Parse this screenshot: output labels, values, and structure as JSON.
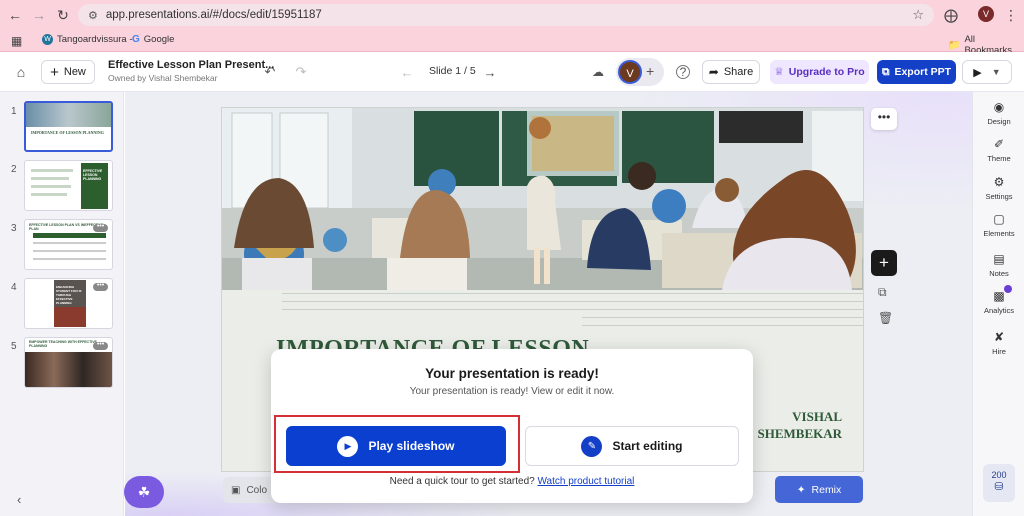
{
  "browser": {
    "url": "app.presentations.ai/#/docs/edit/15951187",
    "profile_initial": "V",
    "bookmarks": [
      {
        "label": "Tangoardvissura -",
        "icon": "wordpress-icon"
      },
      {
        "label": "Google",
        "icon": "google-icon"
      }
    ],
    "all_bookmarks_label": "All Bookmarks"
  },
  "header": {
    "new_label": "New",
    "doc_title": "Effective Lesson Plan Present...",
    "owner": "Owned by Vishal Shembekar",
    "slide_indicator": "Slide 1 / 5",
    "avatar_initial": "V",
    "share_label": "Share",
    "upgrade_label": "Upgrade to Pro",
    "export_label": "Export PPT"
  },
  "slides": [
    {
      "num": "1",
      "caption": "IMPORTANCE OF LESSON PLANNING"
    },
    {
      "num": "2",
      "caption": "EFFECTIVE LESSON PLANNING"
    },
    {
      "num": "3",
      "caption": "EFFECTIVE LESSON PLAN VS INEFFECTIVE PLAN"
    },
    {
      "num": "4",
      "caption": "ENHANCING STUDENT FOCUS THROUGH EFFECTIVE PLANNING"
    },
    {
      "num": "5",
      "caption": "EMPOWER TEACHING WITH EFFECTIVE PLANNING"
    }
  ],
  "slide_content": {
    "title": "IMPORTANCE OF LESSON",
    "author_line1": "VISHAL",
    "author_line2": "SHEMBEKAR"
  },
  "right_tools": [
    {
      "label": "Design",
      "icon": "palette-icon"
    },
    {
      "label": "Theme",
      "icon": "brush-icon"
    },
    {
      "label": "Settings",
      "icon": "gear-icon"
    },
    {
      "label": "Elements",
      "icon": "elements-icon"
    },
    {
      "label": "Notes",
      "icon": "notes-icon"
    },
    {
      "label": "Analytics",
      "icon": "analytics-icon"
    },
    {
      "label": "Hire",
      "icon": "hire-icon"
    }
  ],
  "credits": "200",
  "bottom_bar": {
    "color_label": "Colo",
    "remix_label": "Remix"
  },
  "modal": {
    "title": "Your presentation is ready!",
    "subtitle": "Your presentation is ready! View or edit it now.",
    "play_label": "Play slideshow",
    "edit_label": "Start editing",
    "tour_text": "Need a quick tour to get started?",
    "tour_link": "Watch product tutorial"
  },
  "colors": {
    "accent_blue": "#0a3fd0",
    "highlight_red": "#d22f37",
    "upgrade_purple": "#6b3fd6",
    "slide_title_green": "#2f5a3a"
  }
}
